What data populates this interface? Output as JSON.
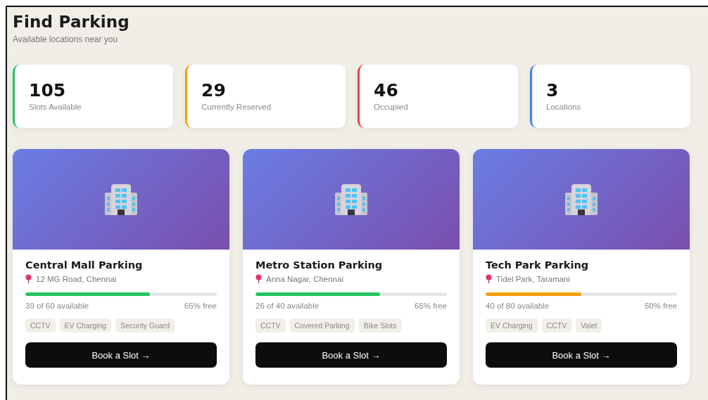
{
  "header": {
    "title": "Find Parking",
    "subtitle": "Available locations near you"
  },
  "stats": [
    {
      "value": "105",
      "label": "Slots Available",
      "color": "#22c55e"
    },
    {
      "value": "29",
      "label": "Currently Reserved",
      "color": "#f59e0b"
    },
    {
      "value": "46",
      "label": "Occupied",
      "color": "#ef4444"
    },
    {
      "value": "3",
      "label": "Locations",
      "color": "#3b82f6"
    }
  ],
  "locations": [
    {
      "name": "Central Mall Parking",
      "address": "12 MG Road, Chennai",
      "level": 0.65,
      "color": "#22c55e",
      "availability": "39 of 60 available",
      "free": "65% free",
      "tags": [
        "CCTV",
        "EV Charging",
        "Security Guard"
      ],
      "button": "Book a Slot →"
    },
    {
      "name": "Metro Station Parking",
      "address": "Anna Nagar, Chennai",
      "level": 0.65,
      "color": "#22c55e",
      "availability": "26 of 40 available",
      "free": "65% free",
      "tags": [
        "CCTV",
        "Covered Parking",
        "Bike Slots"
      ],
      "button": "Book a Slot →"
    },
    {
      "name": "Tech Park Parking",
      "address": "Tidel Park, Taramani",
      "level": 0.5,
      "color": "#f59e0b",
      "availability": "40 of 80 available",
      "free": "50% free",
      "tags": [
        "EV Charging",
        "CCTV",
        "Valet"
      ],
      "button": "Book a Slot →"
    }
  ]
}
